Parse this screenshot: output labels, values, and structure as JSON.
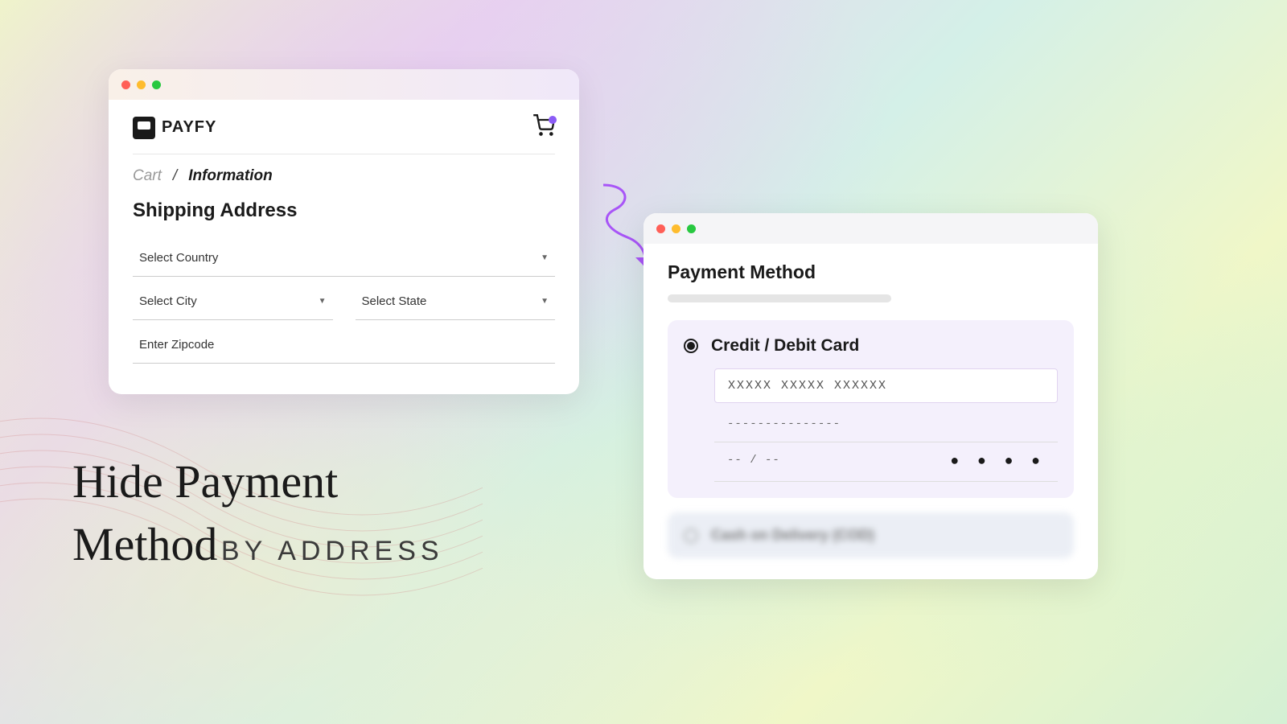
{
  "app": {
    "name": "PAYFY"
  },
  "breadcrumb": {
    "cart": "Cart",
    "info": "Information"
  },
  "shipping": {
    "title": "Shipping Address",
    "country": "Select Country",
    "city": "Select City",
    "state": "Select State",
    "zip": "Enter Zipcode"
  },
  "payment": {
    "title": "Payment Method",
    "card_label": "Credit / Debit Card",
    "card_mask": "XXXXX XXXXX XXXXXX",
    "name_mask": "---------------",
    "expiry_mask": "-- / --",
    "cvv_mask": "● ● ● ●",
    "cod_label": "Cash on Delivery (COD)"
  },
  "tagline": {
    "line1": "Hide Payment",
    "line2": "Method",
    "suffix": "BY ADDRESS"
  }
}
